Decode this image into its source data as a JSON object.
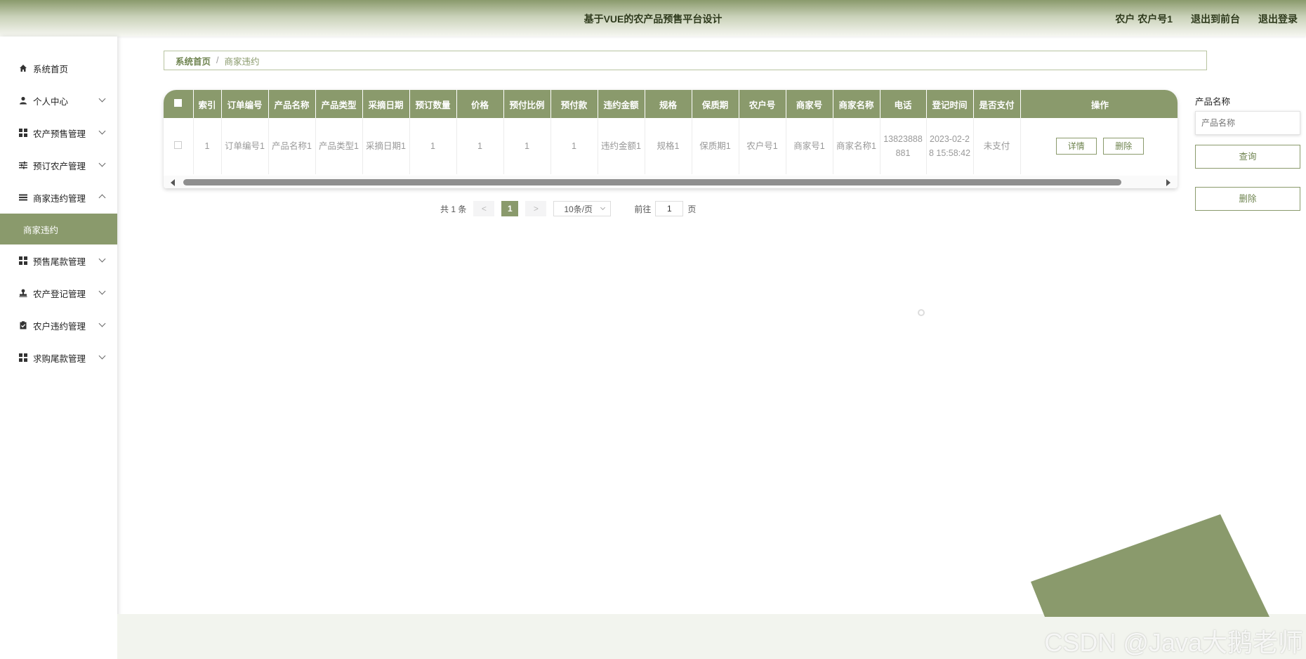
{
  "header": {
    "title": "基于VUE的农产品预售平台设计",
    "user_label": "农户 农户号1",
    "front_label": "退出到前台",
    "logout_label": "退出登录"
  },
  "sidebar": {
    "items": [
      {
        "label": "系统首页",
        "icon": "home-icon"
      },
      {
        "label": "个人中心",
        "icon": "user-icon"
      },
      {
        "label": "农产预售管理",
        "icon": "grid-icon"
      },
      {
        "label": "预订农产管理",
        "icon": "sliders-icon"
      },
      {
        "label": "商家违约管理",
        "icon": "list-icon",
        "expanded": true
      },
      {
        "label": "预售尾款管理",
        "icon": "grid-icon"
      },
      {
        "label": "农产登记管理",
        "icon": "stamp-icon"
      },
      {
        "label": "农户违约管理",
        "icon": "clipboard-icon"
      },
      {
        "label": "求购尾款管理",
        "icon": "grid-icon"
      }
    ],
    "active_sub": "商家违约"
  },
  "breadcrumb": {
    "home": "系统首页",
    "separator": "/",
    "current": "商家违约"
  },
  "table": {
    "headers": [
      "索引",
      "订单编号",
      "产品名称",
      "产品类型",
      "采摘日期",
      "预订数量",
      "价格",
      "预付比例",
      "预付款",
      "违约金额",
      "规格",
      "保质期",
      "农户号",
      "商家号",
      "商家名称",
      "电话",
      "登记时间",
      "是否支付",
      "操作"
    ],
    "rows": [
      {
        "cells": [
          "1",
          "订单编号1",
          "产品名称1",
          "产品类型1",
          "采摘日期1",
          "1",
          "1",
          "1",
          "1",
          "违约金额1",
          "规格1",
          "保质期1",
          "农户号1",
          "商家号1",
          "商家名称1",
          "13823888881",
          "2023-02-28 15:58:42",
          "未支付"
        ],
        "detail_label": "详情",
        "delete_label": "删除"
      }
    ]
  },
  "pagination": {
    "total_label": "共 1 条",
    "prev": "<",
    "current_page": "1",
    "next": ">",
    "page_size": "10条/页",
    "goto_label": "前往",
    "goto_value": "1",
    "page_suffix": "页"
  },
  "search": {
    "label": "产品名称",
    "placeholder": "产品名称",
    "query_label": "查询",
    "delete_label": "删除"
  },
  "watermark": "CSDN @Java大鹅老师",
  "colors": {
    "accent": "#8a9a6c",
    "accent_dark": "#6f8450"
  }
}
